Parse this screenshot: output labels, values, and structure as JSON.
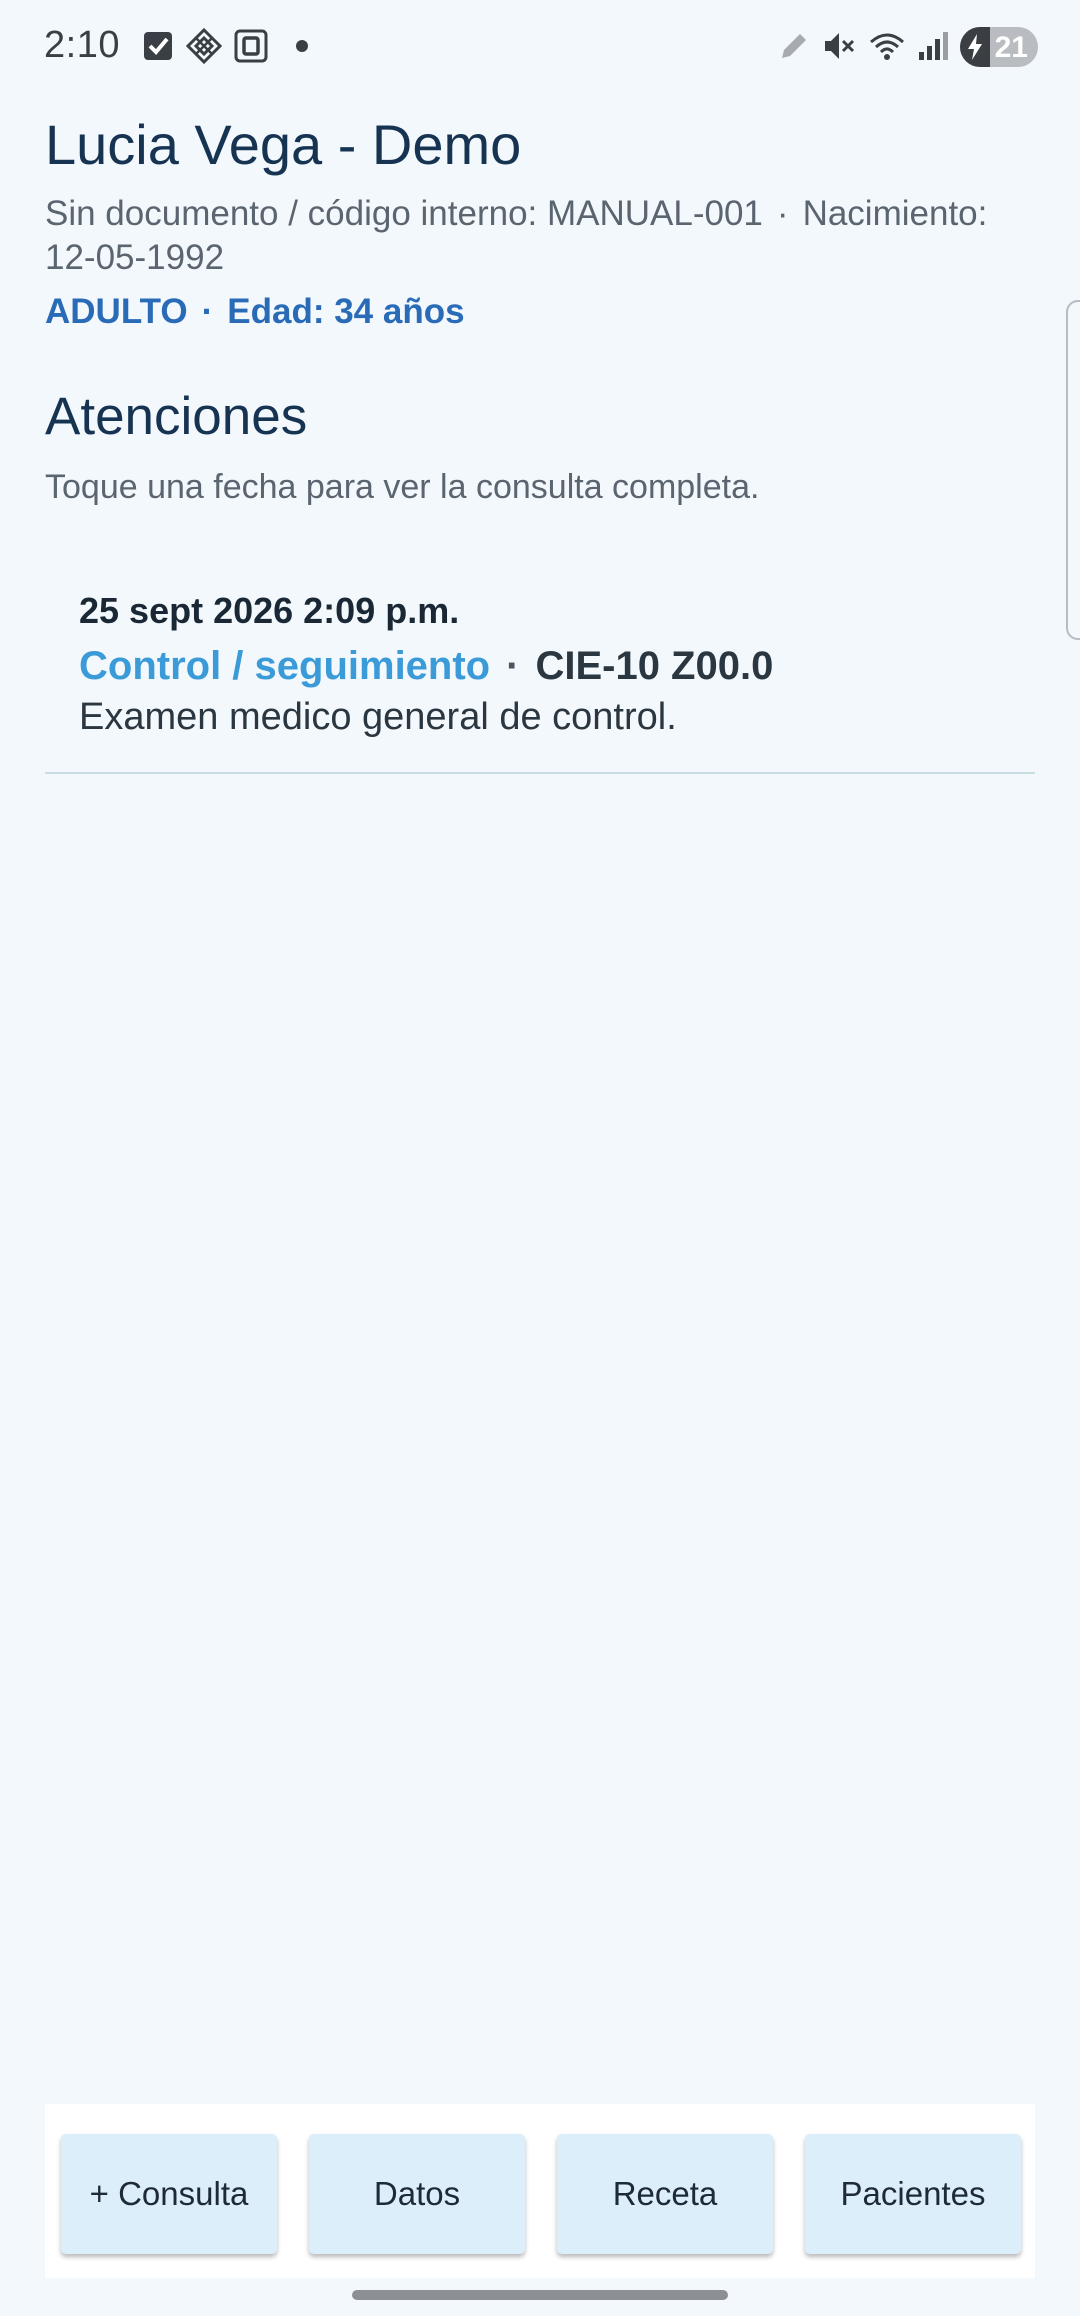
{
  "status_bar": {
    "time": "2:10",
    "icons_left": [
      "checkbox-icon",
      "diamond-grid-icon",
      "square-frame-icon",
      "dot-icon"
    ],
    "icons_right": [
      "pencil-icon",
      "mute-icon",
      "wifi-icon",
      "signal-icon"
    ],
    "battery": {
      "level": 21,
      "label": "21",
      "charging": true
    }
  },
  "patient": {
    "name": "Lucia Vega - Demo",
    "document": "Sin documento / código interno: MANUAL-001",
    "separator": "·",
    "birth": "Nacimiento: 12-05-1992",
    "category": "ADULTO",
    "age": "Edad: 34 años"
  },
  "attentions": {
    "title": "Atenciones",
    "hint": "Toque una fecha para ver la consulta completa.",
    "records": [
      {
        "date": "25 sept 2026 2:09 p.m.",
        "type": "Control / seguimiento",
        "separator": "·",
        "code": "CIE-10 Z00.0",
        "description": "Examen medico general de control."
      }
    ]
  },
  "bottom_nav": {
    "new_consult": "+ Consulta",
    "data": "Datos",
    "prescription": "Receta",
    "patients": "Pacientes"
  },
  "colors": {
    "background": "#f3f8fd",
    "title": "#163452",
    "accent_blue": "#2a6bb8",
    "record_type": "#3a9bd8",
    "button_bg": "#dceef9"
  }
}
